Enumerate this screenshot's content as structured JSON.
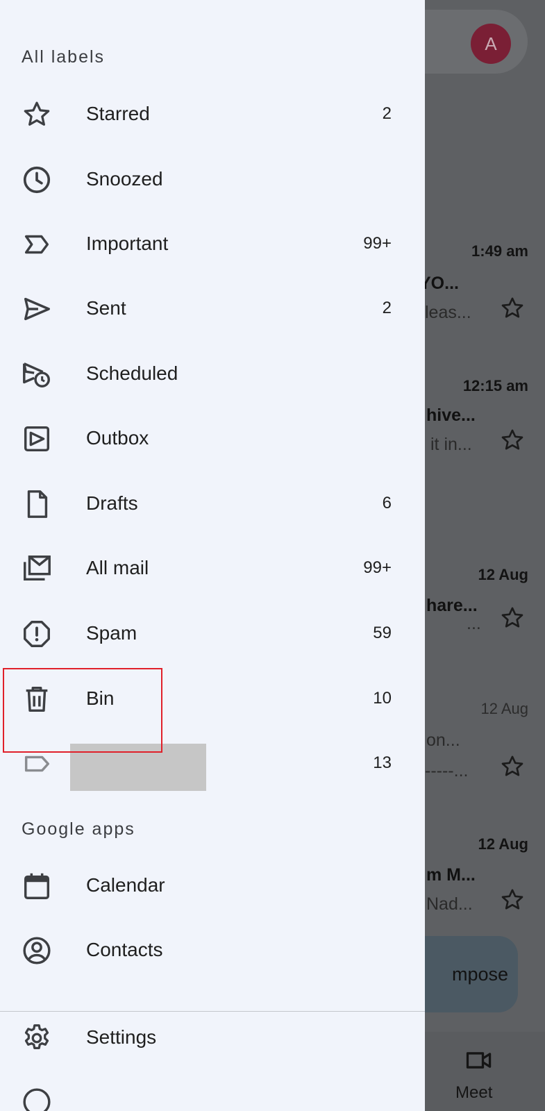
{
  "background": {
    "avatar_letter": "A",
    "emails": [
      {
        "time": "1:49 am",
        "subject": "YO...",
        "snippet": "leas...",
        "bold": true
      },
      {
        "time": "12:15 am",
        "subject": "hive...",
        "snippet": "it in...",
        "bold": true
      },
      {
        "time": "12 Aug",
        "subject": "hare...",
        "snippet": "...",
        "bold": true
      },
      {
        "time": "12 Aug",
        "subject": "on...",
        "snippet": "-----...",
        "bold": false
      },
      {
        "time": "12 Aug",
        "subject": "m M...",
        "snippet": "Nad...",
        "bold": true
      }
    ],
    "compose_label": "mpose",
    "bottom_nav_meet": "Meet"
  },
  "drawer": {
    "all_labels_title": "All labels",
    "google_apps_title": "Google apps",
    "labels": [
      {
        "label": "Starred",
        "count": "2",
        "icon": "star-icon"
      },
      {
        "label": "Snoozed",
        "count": "",
        "icon": "clock-icon"
      },
      {
        "label": "Important",
        "count": "99+",
        "icon": "important-icon"
      },
      {
        "label": "Sent",
        "count": "2",
        "icon": "send-icon"
      },
      {
        "label": "Scheduled",
        "count": "",
        "icon": "scheduled-send-icon"
      },
      {
        "label": "Outbox",
        "count": "",
        "icon": "outbox-icon"
      },
      {
        "label": "Drafts",
        "count": "6",
        "icon": "draft-icon"
      },
      {
        "label": "All mail",
        "count": "99+",
        "icon": "all-mail-icon"
      },
      {
        "label": "Spam",
        "count": "59",
        "icon": "spam-icon"
      },
      {
        "label": "Bin",
        "count": "10",
        "icon": "trash-icon"
      },
      {
        "label": "",
        "count": "13",
        "icon": "label-icon"
      }
    ],
    "apps": [
      {
        "label": "Calendar",
        "icon": "calendar-icon"
      },
      {
        "label": "Contacts",
        "icon": "contacts-icon"
      }
    ],
    "settings_label": "Settings"
  },
  "colors": {
    "drawer_bg": "#f1f4fb",
    "scrim": "#5e6063",
    "highlight_border": "#e0202a",
    "avatar_bg": "#7a1f35"
  }
}
